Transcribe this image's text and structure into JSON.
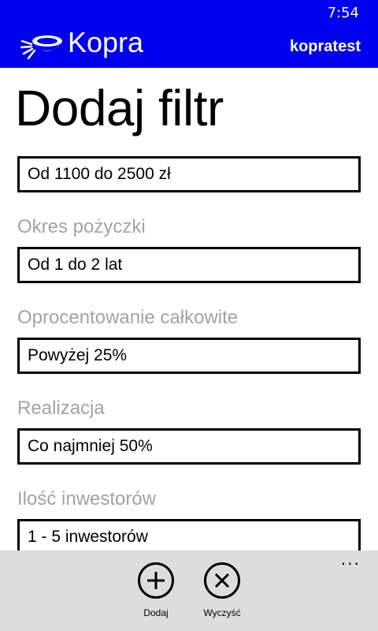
{
  "status_bar": {
    "time": "7:54"
  },
  "header": {
    "app_name": "Kopra",
    "username": "kopratest",
    "background_color": "#0000ee",
    "logo_icon": "kopra-bowl-logo"
  },
  "page": {
    "title": "Dodaj filtr"
  },
  "fields": [
    {
      "label": "",
      "value": "Od 1100 do 2500 zł"
    },
    {
      "label": "Okres pożyczki",
      "value": "Od 1 do 2 lat"
    },
    {
      "label": "Oprocentowanie całkowite",
      "value": "Powyżej 25%"
    },
    {
      "label": "Realizacja",
      "value": "Co najmniej 50%"
    },
    {
      "label": "Ilość inwestorów",
      "value": "1 - 5 inwestorów"
    }
  ],
  "app_bar": {
    "add_label": "Dodaj",
    "add_icon": "plus-circle-icon",
    "clear_label": "Wyczyść",
    "clear_icon": "x-circle-icon",
    "more_label": "...",
    "background_color": "#dddddd"
  }
}
